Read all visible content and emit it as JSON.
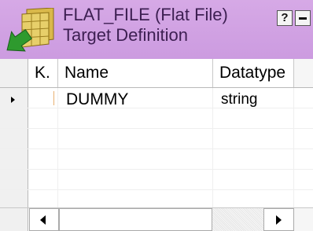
{
  "window": {
    "title_line1": "FLAT_FILE (Flat File)",
    "title_line2": "Target Definition",
    "help_button_label": "?",
    "titlebar_color": "#d3a5e4",
    "icon": "flat-file-target-icon"
  },
  "grid": {
    "columns": [
      "K.",
      "Name",
      "Datatype"
    ],
    "rows": [
      {
        "key": "",
        "name": "DUMMY",
        "datatype": "string",
        "current": true
      },
      {
        "key": "",
        "name": "",
        "datatype": "",
        "current": false
      },
      {
        "key": "",
        "name": "",
        "datatype": "",
        "current": false
      },
      {
        "key": "",
        "name": "",
        "datatype": "",
        "current": false
      },
      {
        "key": "",
        "name": "",
        "datatype": "",
        "current": false
      },
      {
        "key": "",
        "name": "",
        "datatype": "",
        "current": false
      }
    ]
  },
  "scrollbar": {
    "left_arrow_icon": "arrow-left-icon",
    "right_arrow_icon": "arrow-right-icon"
  }
}
